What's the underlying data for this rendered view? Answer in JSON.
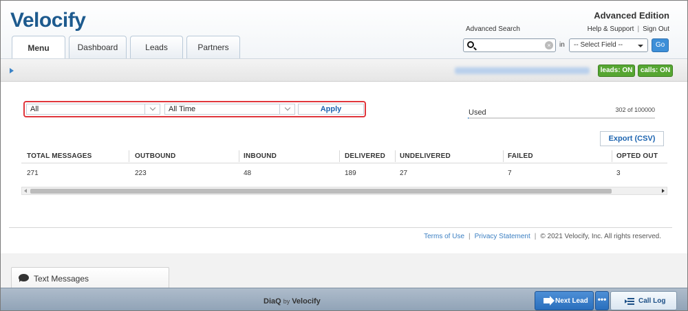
{
  "header": {
    "logo": "Velocify",
    "edition": "Advanced Edition",
    "links": [
      "Help & Support",
      "Sign Out"
    ],
    "advanced_search_label": "Advanced Search",
    "search": {
      "value": "",
      "placeholder": ""
    },
    "in_label": "in",
    "field_select": "-- Select Field --",
    "go_label": "Go"
  },
  "tabs": [
    {
      "label": "Menu",
      "active": true
    },
    {
      "label": "Dashboard"
    },
    {
      "label": "Leads"
    },
    {
      "label": "Partners"
    }
  ],
  "statusbar": {
    "leads_badge": "leads: ON",
    "calls_badge": "calls: ON"
  },
  "filters": {
    "type": "All",
    "period": "All Time",
    "apply_label": "Apply"
  },
  "usage": {
    "label": "Used",
    "count_text": "302 of 100000",
    "fraction": 0.00302
  },
  "export_label": "Export (CSV)",
  "table": {
    "headers": [
      "TOTAL MESSAGES",
      "OUTBOUND",
      "INBOUND",
      "DELIVERED",
      "UNDELIVERED",
      "FAILED",
      "OPTED OUT"
    ],
    "row": [
      "271",
      "223",
      "48",
      "189",
      "27",
      "7",
      "3"
    ]
  },
  "footer": {
    "terms": "Terms of Use",
    "privacy": "Privacy Statement",
    "copyright": "© 2021 Velocify, Inc. All rights reserved."
  },
  "text_messages_tab": "Text Messages",
  "bottombar": {
    "product": "DiaQ",
    "by": "by",
    "brand": "Velocify",
    "next_lead": "Next Lead",
    "more": "•••",
    "call_log": "Call Log"
  },
  "colors": {
    "brand_blue": "#1d5a8e",
    "accent_green": "#56a632",
    "highlight_red": "#e0353b",
    "link_blue": "#1c64b0"
  }
}
